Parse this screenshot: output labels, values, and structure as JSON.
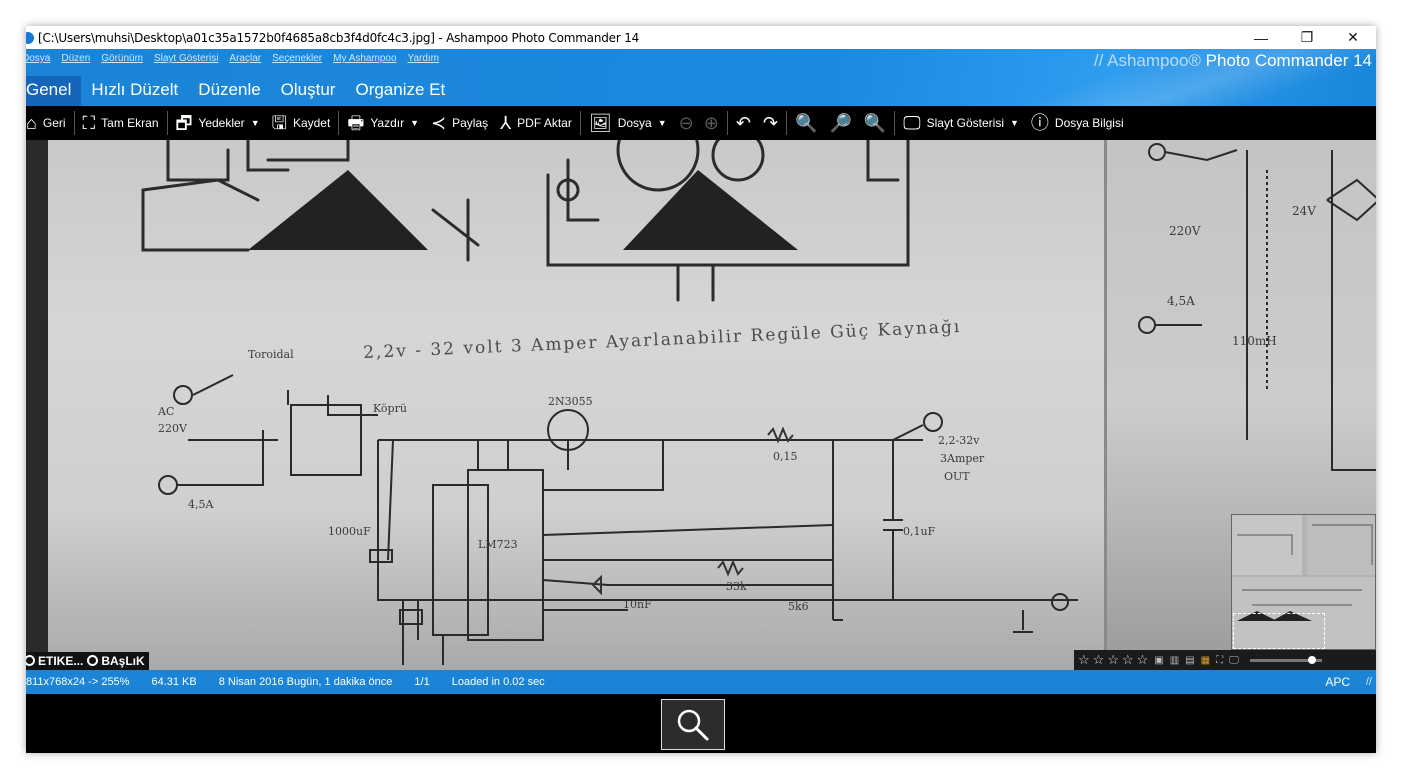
{
  "window": {
    "title": "[C:\\Users\\muhsi\\Desktop\\a01c35a1572b0f4685a8cb3f4d0fc4c3.jpg] - Ashampoo Photo Commander 14",
    "minimize": "—",
    "restore": "❐",
    "close": "✕"
  },
  "menu": [
    "Dosya",
    "Düzen",
    "Görünüm",
    "Slayt Gösterisi",
    "Araçlar",
    "Seçenekler",
    "My Ashampoo",
    "Yardım"
  ],
  "brand": {
    "prefix": "// Ashampoo®",
    "name": "Photo Commander 14"
  },
  "tabs": [
    "Genel",
    "Hızlı Düzelt",
    "Düzenle",
    "Oluştur",
    "Organize Et"
  ],
  "toolbar": {
    "back": "Geri",
    "fullscreen": "Tam Ekran",
    "backups": "Yedekler",
    "save": "Kaydet",
    "print": "Yazdır",
    "share": "Paylaş",
    "pdf": "PDF Aktar",
    "file": "Dosya",
    "slideshow": "Slayt Gösterisi",
    "fileinfo": "Dosya Bilgisi"
  },
  "image": {
    "handwritten_title": "2,2v - 32 volt  3 Amper  Ayarlanabilir  Regüle Güç Kaynağı"
  },
  "overlays": {
    "tag_label": "ETIKE...",
    "title_label": "BAşLıK"
  },
  "status": {
    "dimensions": "811x768x24 -> 255%",
    "filesize": "64.31 KB",
    "date": "8 Nisan 2016 Bugün, 1 dakika önce",
    "position": "1/1",
    "loadtime": "Loaded in 0.02 sec",
    "mode": "APC",
    "grip": "//"
  },
  "rating": {
    "stars": 5,
    "value": 0,
    "zoom_fraction": 0.82
  },
  "colors": {
    "accent": "#1b84d6",
    "toolbar_bg": "#000000",
    "active_tab": "#1565b8"
  },
  "icons": [
    "app-icon",
    "home-icon",
    "fullscreen-icon",
    "backups-icon",
    "save-icon",
    "print-icon",
    "share-icon",
    "pdf-icon",
    "file-icon",
    "prev-icon",
    "next-icon",
    "rotate-left-icon",
    "rotate-right-icon",
    "zoom-out-icon",
    "zoom-fit-icon",
    "zoom-in-icon",
    "slideshow-icon",
    "info-icon",
    "search-icon"
  ]
}
